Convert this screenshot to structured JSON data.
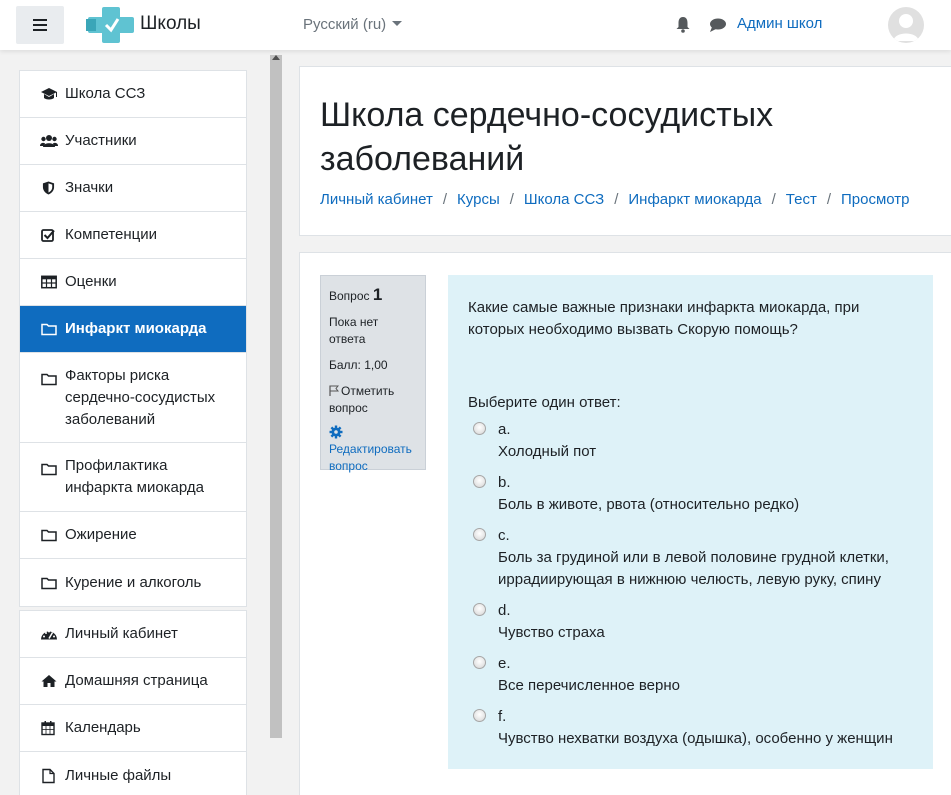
{
  "navbar": {
    "site_name": "Школы",
    "language": "Русский (ru)",
    "user_name": "Админ школ"
  },
  "sidebar": {
    "course_items": [
      {
        "label": "Школа ССЗ",
        "icon": "graduation-cap-icon"
      },
      {
        "label": "Участники",
        "icon": "users-icon"
      },
      {
        "label": "Значки",
        "icon": "shield-icon"
      },
      {
        "label": "Компетенции",
        "icon": "checkbox-icon"
      },
      {
        "label": "Оценки",
        "icon": "table-icon"
      },
      {
        "label": "Инфаркт миокарда",
        "icon": "folder-icon",
        "active": true
      },
      {
        "label": "Факторы риска сердечно-сосудистых заболеваний",
        "icon": "folder-icon"
      },
      {
        "label": "Профилактика инфаркта миокарда",
        "icon": "folder-icon"
      },
      {
        "label": "Ожирение",
        "icon": "folder-icon"
      },
      {
        "label": "Курение и алкоголь",
        "icon": "folder-icon"
      }
    ],
    "site_items": [
      {
        "label": "Личный кабинет",
        "icon": "dashboard-icon"
      },
      {
        "label": "Домашняя страница",
        "icon": "home-icon"
      },
      {
        "label": "Календарь",
        "icon": "calendar-icon"
      },
      {
        "label": "Личные файлы",
        "icon": "file-icon"
      }
    ]
  },
  "header": {
    "title": "Школа сердечно-сосудистых заболеваний",
    "breadcrumb": [
      "Личный кабинет",
      "Курсы",
      "Школа ССЗ",
      "Инфаркт миокарда",
      "Тест",
      "Просмотр"
    ]
  },
  "question": {
    "label": "Вопрос",
    "number": "1",
    "status": "Пока нет ответа",
    "score": "Балл: 1,00",
    "flag_label": "Отметить вопрос",
    "edit_label": "Редактировать вопрос",
    "text": "Какие самые важные признаки инфаркта миокарда, при которых необходимо вызвать Скорую помощь?",
    "prompt": "Выберите один ответ:",
    "answers": [
      {
        "letter": "a.",
        "text": "Холодный пот"
      },
      {
        "letter": "b.",
        "text": "Боль в животе, рвота (относительно редко)"
      },
      {
        "letter": "c.",
        "text": "Боль за грудиной или в левой половине грудной клетки, иррадиирующая в нижнюю челюсть, левую руку, спину"
      },
      {
        "letter": "d.",
        "text": "Чувство страха"
      },
      {
        "letter": "e.",
        "text": "Все перечисленное верно"
      },
      {
        "letter": "f.",
        "text": "Чувство нехватки воздуха (одышка), особенно у женщин"
      }
    ]
  },
  "colors": {
    "brand": "#0f6cbf",
    "logo": "#5fc3d2",
    "question_bg": "#def2f8",
    "info_bg": "#dee2e6"
  }
}
